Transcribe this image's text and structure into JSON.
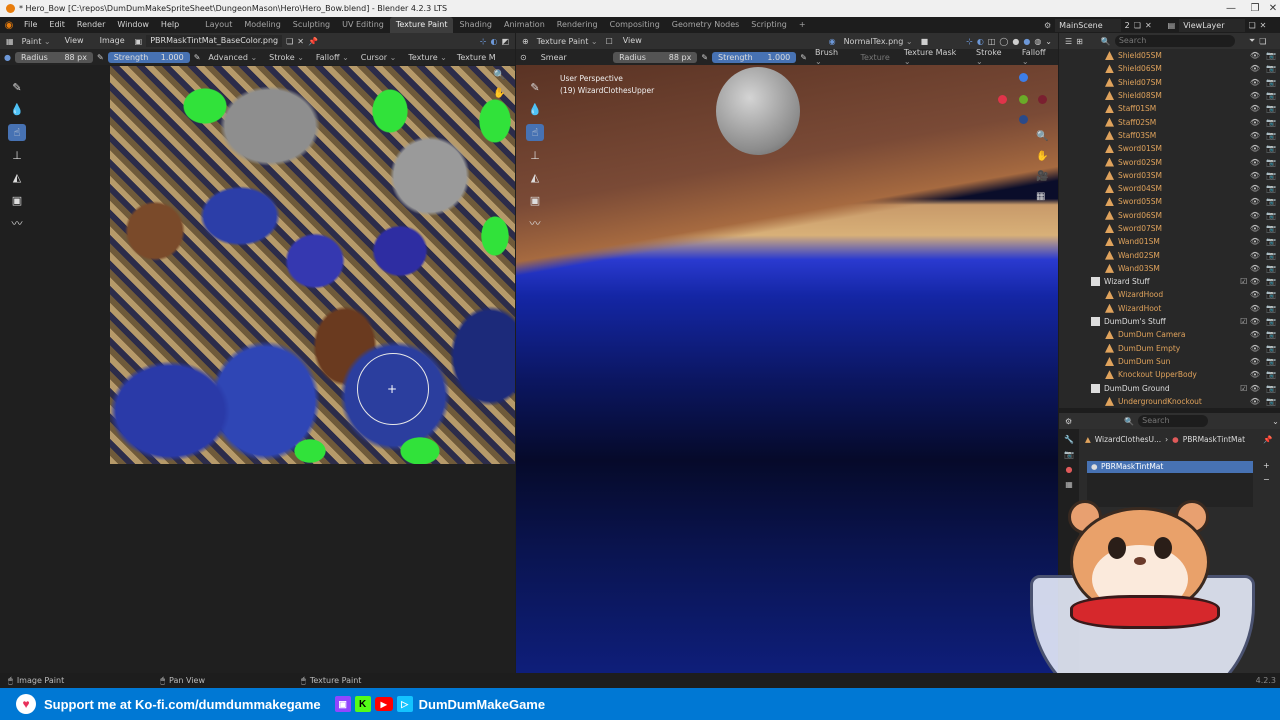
{
  "window": {
    "title": "* Hero_Bow [C:\\repos\\DumDumMakeSpriteSheet\\DungeonMason\\Hero\\Hero_Bow.blend] - Blender 4.2.3 LTS"
  },
  "menu": [
    "File",
    "Edit",
    "Render",
    "Window",
    "Help"
  ],
  "workspaces": [
    "Layout",
    "Modeling",
    "Sculpting",
    "UV Editing",
    "Texture Paint",
    "Shading",
    "Animation",
    "Rendering",
    "Compositing",
    "Geometry Nodes",
    "Scripting"
  ],
  "active_workspace": "Texture Paint",
  "scene": {
    "name": "MainScene",
    "view_layer": "ViewLayer",
    "scene_count": "2"
  },
  "image_editor": {
    "mode": "Paint",
    "view_menu": "View",
    "image_menu": "Image",
    "image_name": "PBRMaskTintMat_BaseColor.png",
    "tool_settings": {
      "radius_label": "Radius",
      "radius_value": "88 px",
      "strength_label": "Strength",
      "strength_value": "1.000",
      "dropdowns": [
        "Advanced",
        "Stroke",
        "Falloff",
        "Cursor",
        "Texture",
        "Texture M"
      ]
    }
  },
  "viewport": {
    "mode": "Texture Paint",
    "view_menu": "View",
    "texture_name": "NormalTex.png",
    "brush_name": "Smear",
    "overlay_title": "User Perspective",
    "overlay_object": "(19) WizardClothesUpper",
    "tool_settings": {
      "radius_label": "Radius",
      "radius_value": "88 px",
      "strength_label": "Strength",
      "strength_value": "1.000",
      "dropdowns": [
        "Brush",
        "Texture",
        "Texture Mask",
        "Stroke",
        "Falloff"
      ]
    }
  },
  "outliner": {
    "search_placeholder": "Search",
    "items": [
      {
        "name": "Shield05SM",
        "type": "obj"
      },
      {
        "name": "Shield06SM",
        "type": "obj"
      },
      {
        "name": "Shield07SM",
        "type": "obj"
      },
      {
        "name": "Shield08SM",
        "type": "obj"
      },
      {
        "name": "Staff01SM",
        "type": "obj"
      },
      {
        "name": "Staff02SM",
        "type": "obj"
      },
      {
        "name": "Staff03SM",
        "type": "obj"
      },
      {
        "name": "Sword01SM",
        "type": "obj"
      },
      {
        "name": "Sword02SM",
        "type": "obj"
      },
      {
        "name": "Sword03SM",
        "type": "obj"
      },
      {
        "name": "Sword04SM",
        "type": "obj"
      },
      {
        "name": "Sword05SM",
        "type": "obj"
      },
      {
        "name": "Sword06SM",
        "type": "obj"
      },
      {
        "name": "Sword07SM",
        "type": "obj"
      },
      {
        "name": "Wand01SM",
        "type": "obj"
      },
      {
        "name": "Wand02SM",
        "type": "obj"
      },
      {
        "name": "Wand03SM",
        "type": "obj"
      },
      {
        "name": "Wizard Stuff",
        "type": "coll"
      },
      {
        "name": "WizardHood",
        "type": "obj"
      },
      {
        "name": "WizardHoot",
        "type": "obj"
      },
      {
        "name": "DumDum's Stuff",
        "type": "coll"
      },
      {
        "name": "DumDum Camera",
        "type": "obj"
      },
      {
        "name": "DumDum Empty",
        "type": "obj"
      },
      {
        "name": "DumDum Sun",
        "type": "obj"
      },
      {
        "name": "Knockout UpperBody",
        "type": "obj"
      },
      {
        "name": "DumDum Ground",
        "type": "coll"
      },
      {
        "name": "UndergroundKnockout",
        "type": "obj"
      }
    ]
  },
  "properties": {
    "search_placeholder": "Search",
    "object_name": "WizardClothesU...",
    "material_name": "PBRMaskTintMat",
    "slot_name": "PBRMaskTintMat"
  },
  "statusbar": {
    "items": [
      "Image Paint",
      "Pan View",
      "Texture Paint"
    ],
    "version": "4.2.3"
  },
  "banner": {
    "support_text": "Support me at Ko-fi.com/dumdummakegame",
    "channel_name": "DumDumMakeGame"
  },
  "colors": {
    "accent": "#4772b3",
    "banner": "#0078d4",
    "header": "#303030"
  }
}
